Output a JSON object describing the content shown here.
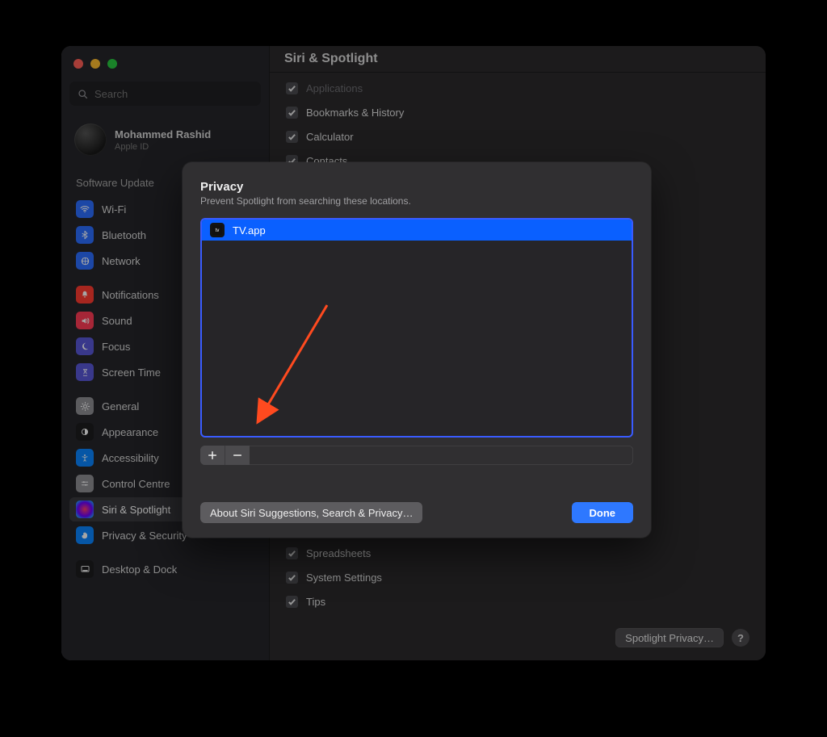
{
  "header": {
    "title": "Siri & Spotlight"
  },
  "account": {
    "name": "Mohammed Rashid",
    "sub": "Apple ID"
  },
  "search": {
    "placeholder": "Search"
  },
  "sidebar": {
    "softwareUpdateLabel": "Software Update",
    "items": [
      {
        "label": "Wi-Fi"
      },
      {
        "label": "Bluetooth"
      },
      {
        "label": "Network"
      },
      {
        "label": "Notifications"
      },
      {
        "label": "Sound"
      },
      {
        "label": "Focus"
      },
      {
        "label": "Screen Time"
      },
      {
        "label": "General"
      },
      {
        "label": "Appearance"
      },
      {
        "label": "Accessibility"
      },
      {
        "label": "Control Centre"
      },
      {
        "label": "Siri & Spotlight"
      },
      {
        "label": "Privacy & Security"
      },
      {
        "label": "Desktop & Dock"
      }
    ]
  },
  "checks": {
    "applicationsLabel": "Applications",
    "items": [
      {
        "label": "Bookmarks & History"
      },
      {
        "label": "Calculator"
      },
      {
        "label": "Contacts"
      },
      {
        "label": "Spreadsheets"
      },
      {
        "label": "System Settings"
      },
      {
        "label": "Tips"
      }
    ]
  },
  "sheet": {
    "title": "Privacy",
    "desc": "Prevent Spotlight from searching these locations.",
    "list": [
      {
        "name": "TV.app"
      }
    ],
    "aboutBtn": "About Siri Suggestions, Search & Privacy…",
    "doneBtn": "Done"
  },
  "footerBtn": "Spotlight Privacy…",
  "helpGlyph": "?"
}
